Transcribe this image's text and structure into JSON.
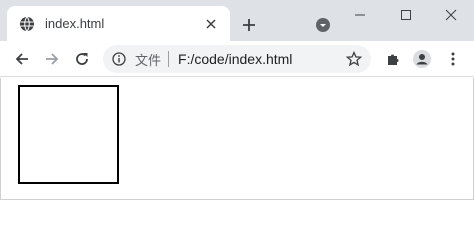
{
  "tab": {
    "title": "index.html",
    "favicon": "globe-icon",
    "close_icon": "close-icon"
  },
  "titlebar": {
    "new_tab_icon": "plus-icon",
    "profile_menu_icon": "caret-down-icon",
    "minimize_icon": "minimize-icon",
    "maximize_icon": "maximize-icon",
    "close_window_icon": "close-icon"
  },
  "toolbar": {
    "back_icon": "arrow-left-icon",
    "forward_icon": "arrow-right-icon",
    "reload_icon": "reload-icon",
    "extensions_icon": "puzzle-icon",
    "profile_icon": "avatar-icon",
    "menu_icon": "kebab-icon"
  },
  "omnibox": {
    "chip_label": "文件",
    "url": "F:/code/index.html",
    "info_icon": "info-icon",
    "bookmark_icon": "star-icon"
  },
  "colors": {
    "titlebar_bg": "#dee1e6",
    "omnibox_bg": "#f1f3f4",
    "square_border": "#000000"
  }
}
